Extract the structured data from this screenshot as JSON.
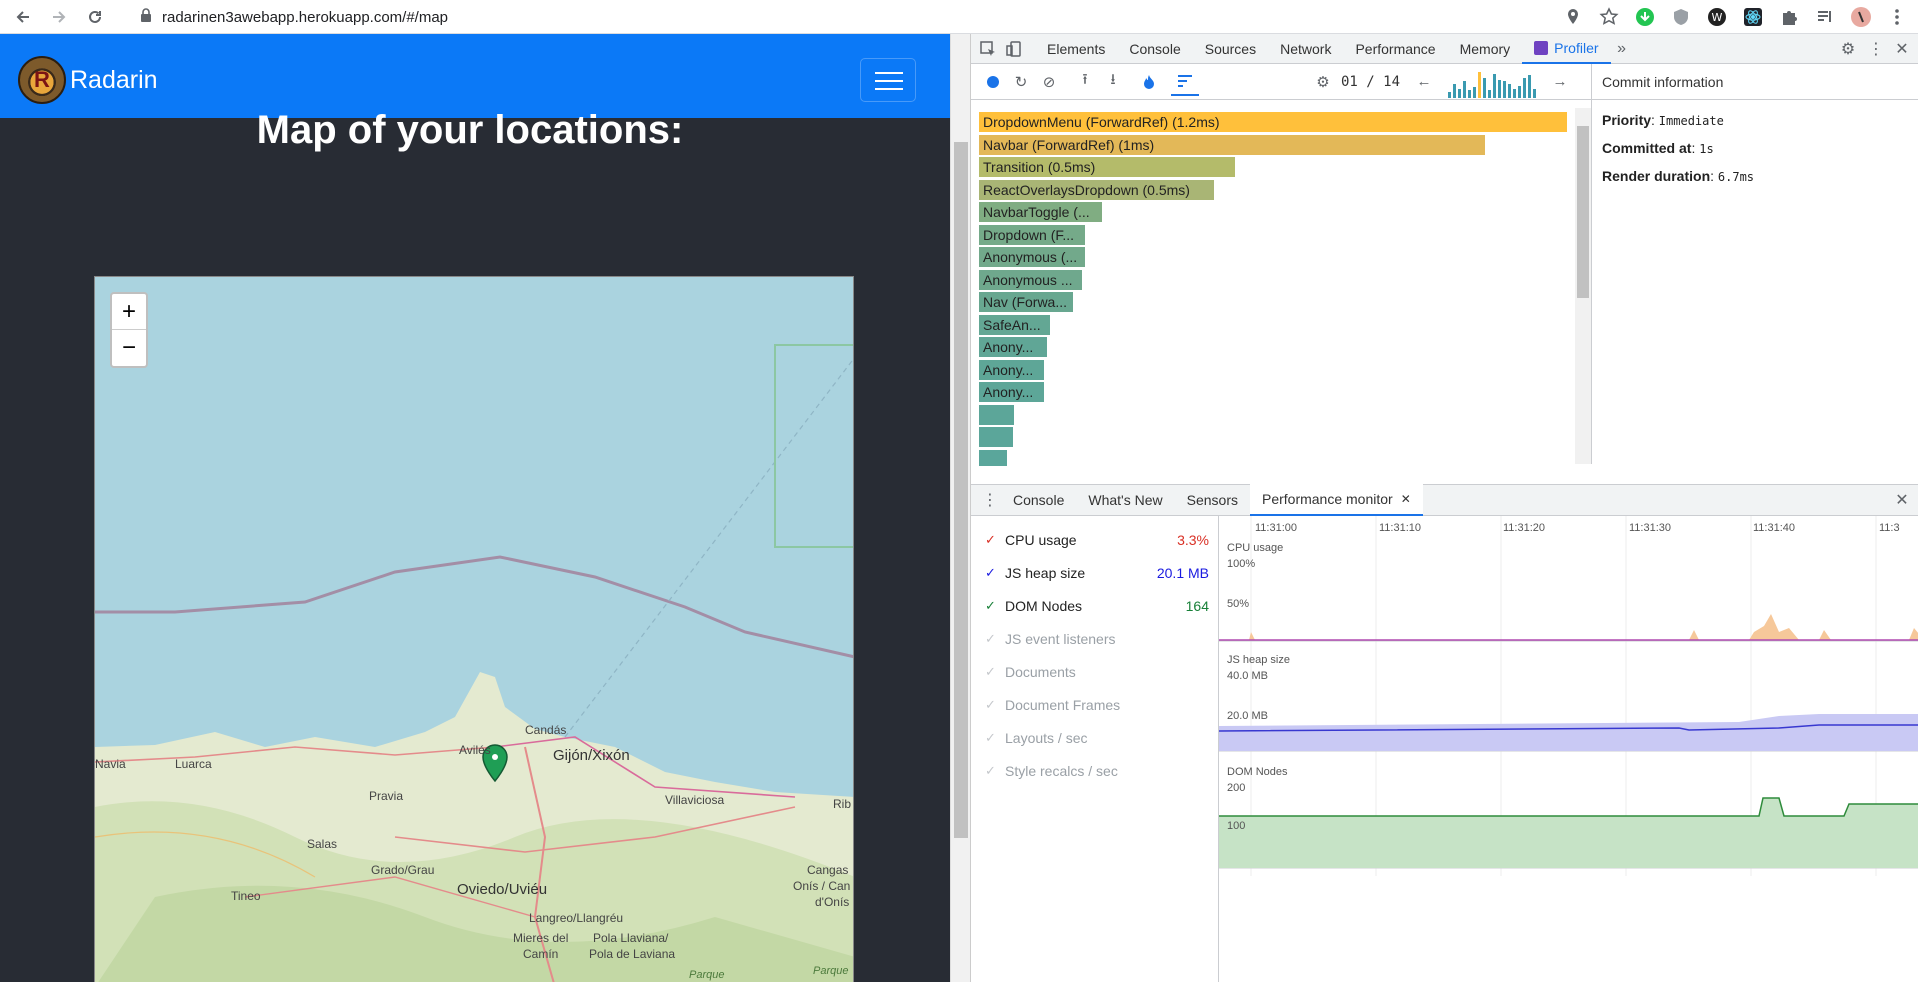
{
  "browser": {
    "url": "radarinen3awebapp.herokuapp.com/#/map",
    "icons": [
      "back-arrow-icon",
      "forward-arrow-icon",
      "reload-icon",
      "lock-icon",
      "location-icon",
      "star-icon"
    ]
  },
  "app": {
    "brand": "Radarin",
    "logo_letter": "R",
    "heading": "Map of your locations:",
    "zoom_in": "+",
    "zoom_out": "−",
    "map_places": [
      {
        "label": "Candás"
      },
      {
        "label": "Gijón/Xixón"
      },
      {
        "label": "Navia"
      },
      {
        "label": "Luarca"
      },
      {
        "label": "Avilés"
      },
      {
        "label": "Pravia"
      },
      {
        "label": "Villaviciosa"
      },
      {
        "label": "Rib"
      },
      {
        "label": "Salas"
      },
      {
        "label": "Grado/Grau"
      },
      {
        "label": "Oviedo/Uviéu"
      },
      {
        "label": "Cangas"
      },
      {
        "label": "Onís / Can"
      },
      {
        "label": "d'Onís"
      },
      {
        "label": "Tineo"
      },
      {
        "label": "Langreo/Llangréu"
      },
      {
        "label": "Mieres del"
      },
      {
        "label": "Camín"
      },
      {
        "label": "Pola Llaviana/"
      },
      {
        "label": "Pola de Laviana"
      },
      {
        "label": "Parque"
      },
      {
        "label": "Parque"
      }
    ]
  },
  "devtools": {
    "tabs": [
      "Elements",
      "Console",
      "Sources",
      "Network",
      "Performance",
      "Memory",
      "Profiler"
    ],
    "active_tab": "Profiler",
    "commit_counter": "01 / 14",
    "commit_info_title": "Commit information",
    "commit_info": [
      {
        "label": "Priority",
        "value": "Immediate"
      },
      {
        "label": "Committed at",
        "value": "1s"
      },
      {
        "label": "Render duration",
        "value": "6.7ms"
      }
    ],
    "ranked": [
      {
        "label": "DropdownMenu (ForwardRef) (1.2ms)",
        "fraction": 1.0,
        "color": "#ffc03b"
      },
      {
        "label": "Navbar (ForwardRef) (1ms)",
        "fraction": 0.86,
        "color": "#e3b858"
      },
      {
        "label": "Transition (0.5ms)",
        "fraction": 0.435,
        "color": "#b4bb6a"
      },
      {
        "label": "ReactOverlaysDropdown (0.5ms)",
        "fraction": 0.4,
        "color": "#a9b575"
      },
      {
        "label": "NavbarToggle (...",
        "fraction": 0.21,
        "color": "#80ad82"
      },
      {
        "label": "Dropdown (F...",
        "fraction": 0.18,
        "color": "#75aa89"
      },
      {
        "label": "Anonymous (...",
        "fraction": 0.18,
        "color": "#72a98b"
      },
      {
        "label": "Anonymous ...",
        "fraction": 0.175,
        "color": "#6fa88d"
      },
      {
        "label": "Nav (Forwa...",
        "fraction": 0.16,
        "color": "#68a790"
      },
      {
        "label": "SafeAn...",
        "fraction": 0.12,
        "color": "#63a794"
      },
      {
        "label": "Anony...",
        "fraction": 0.115,
        "color": "#60a696"
      },
      {
        "label": "Anony...",
        "fraction": 0.11,
        "color": "#5ea697"
      },
      {
        "label": "Anony...",
        "fraction": 0.11,
        "color": "#5da698"
      },
      {
        "label": "",
        "fraction": 0.06,
        "color": "#5ca699"
      },
      {
        "label": "",
        "fraction": 0.057,
        "color": "#5ba69a"
      },
      {
        "label": "",
        "fraction": 0.048,
        "color": "#5aa69b"
      }
    ],
    "commit_bars": [
      0.2,
      0.45,
      0.3,
      0.55,
      0.25,
      0.35,
      0.85,
      0.65,
      0.25,
      0.8,
      0.6,
      0.55,
      0.45,
      0.3,
      0.4,
      0.65,
      0.75,
      0.3
    ],
    "drawer_tabs": [
      "Console",
      "What's New",
      "Sensors",
      "Performance monitor"
    ],
    "metrics": [
      {
        "label": "CPU usage",
        "value": "3.3%",
        "enabled": true,
        "color": "#d93025"
      },
      {
        "label": "JS heap size",
        "value": "20.1 MB",
        "enabled": true,
        "color": "#1a1ae0"
      },
      {
        "label": "DOM Nodes",
        "value": "164",
        "enabled": true,
        "color": "#188038"
      },
      {
        "label": "JS event listeners",
        "value": "",
        "enabled": false,
        "color": ""
      },
      {
        "label": "Documents",
        "value": "",
        "enabled": false,
        "color": ""
      },
      {
        "label": "Document Frames",
        "value": "",
        "enabled": false,
        "color": ""
      },
      {
        "label": "Layouts / sec",
        "value": "",
        "enabled": false,
        "color": ""
      },
      {
        "label": "Style recalcs / sec",
        "value": "",
        "enabled": false,
        "color": ""
      }
    ],
    "timeline": [
      "11:31:00",
      "11:31:10",
      "11:31:20",
      "11:31:30",
      "11:31:40",
      "11:3"
    ],
    "graph_labels": {
      "cpu": "CPU usage",
      "cpu_100": "100%",
      "cpu_50": "50%",
      "heap": "JS heap size",
      "heap_40": "40.0 MB",
      "heap_20": "20.0 MB",
      "dom": "DOM Nodes",
      "dom_200": "200",
      "dom_100": "100"
    }
  }
}
